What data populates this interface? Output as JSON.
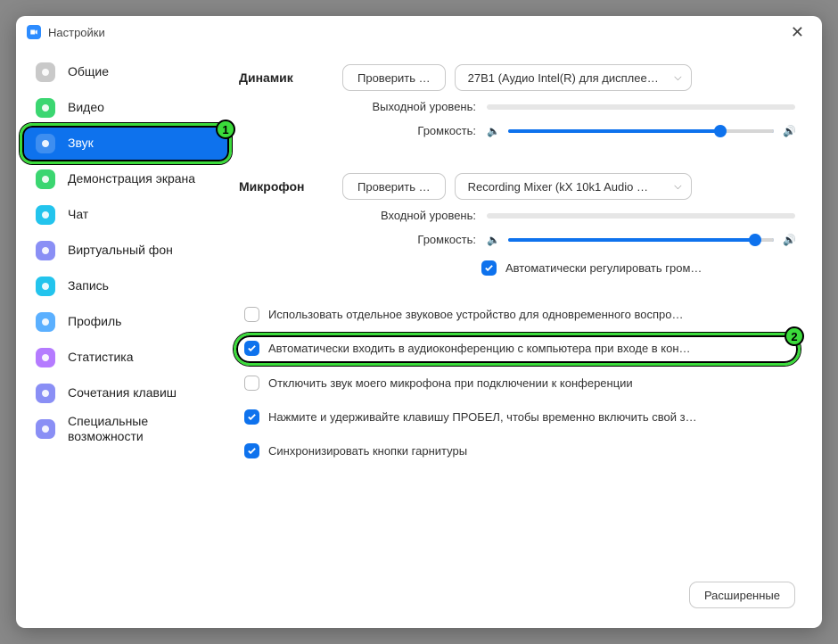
{
  "window": {
    "title": "Настройки"
  },
  "sidebar": {
    "items": [
      {
        "label": "Общие",
        "icon": "gear-icon",
        "color": "#c9c9c9"
      },
      {
        "label": "Видео",
        "icon": "camera-icon",
        "color": "#3bd671"
      },
      {
        "label": "Звук",
        "icon": "headphones-icon",
        "color": "#ffffff",
        "selected": true
      },
      {
        "label": "Демонстрация экрана",
        "icon": "share-icon",
        "color": "#3bd671"
      },
      {
        "label": "Чат",
        "icon": "chat-icon",
        "color": "#23c4ed"
      },
      {
        "label": "Виртуальный фон",
        "icon": "background-icon",
        "color": "#8a8ff5"
      },
      {
        "label": "Запись",
        "icon": "record-icon",
        "color": "#23c4ed"
      },
      {
        "label": "Профиль",
        "icon": "profile-icon",
        "color": "#5bb0ff"
      },
      {
        "label": "Статистика",
        "icon": "stats-icon",
        "color": "#b57bff"
      },
      {
        "label": "Сочетания клавиш",
        "icon": "keyboard-icon",
        "color": "#8a8ff5"
      },
      {
        "label": "Специальные возможности",
        "icon": "accessibility-icon",
        "color": "#8a8ff5"
      }
    ]
  },
  "speaker": {
    "section_label": "Динамик",
    "test_button": "Проверить …",
    "device": "27B1 (Аудио Intel(R) для дисплее…",
    "output_level_label": "Выходной уровень:",
    "volume_label": "Громкость:",
    "volume_percent": 80
  },
  "microphone": {
    "section_label": "Микрофон",
    "test_button": "Проверить …",
    "device": "Recording Mixer (kX 10k1 Audio …",
    "input_level_label": "Входной уровень:",
    "volume_label": "Громкость:",
    "volume_percent": 93,
    "auto_adjust_label": "Автоматически регулировать гром…",
    "auto_adjust_checked": true
  },
  "options": [
    {
      "label": "Использовать отдельное звуковое устройство для одновременного воспро…",
      "checked": false
    },
    {
      "label": "Автоматически входить в аудиоконференцию с компьютера при входе в кон…",
      "checked": true,
      "highlighted": true
    },
    {
      "label": "Отключить звук моего микрофона при подключении к конференции",
      "checked": false
    },
    {
      "label": "Нажмите и удерживайте клавишу ПРОБЕЛ, чтобы временно включить свой з…",
      "checked": true
    },
    {
      "label": "Синхронизировать кнопки гарнитуры",
      "checked": true
    }
  ],
  "advanced_button": "Расширенные",
  "markers": {
    "sidebar": "1",
    "option": "2"
  }
}
